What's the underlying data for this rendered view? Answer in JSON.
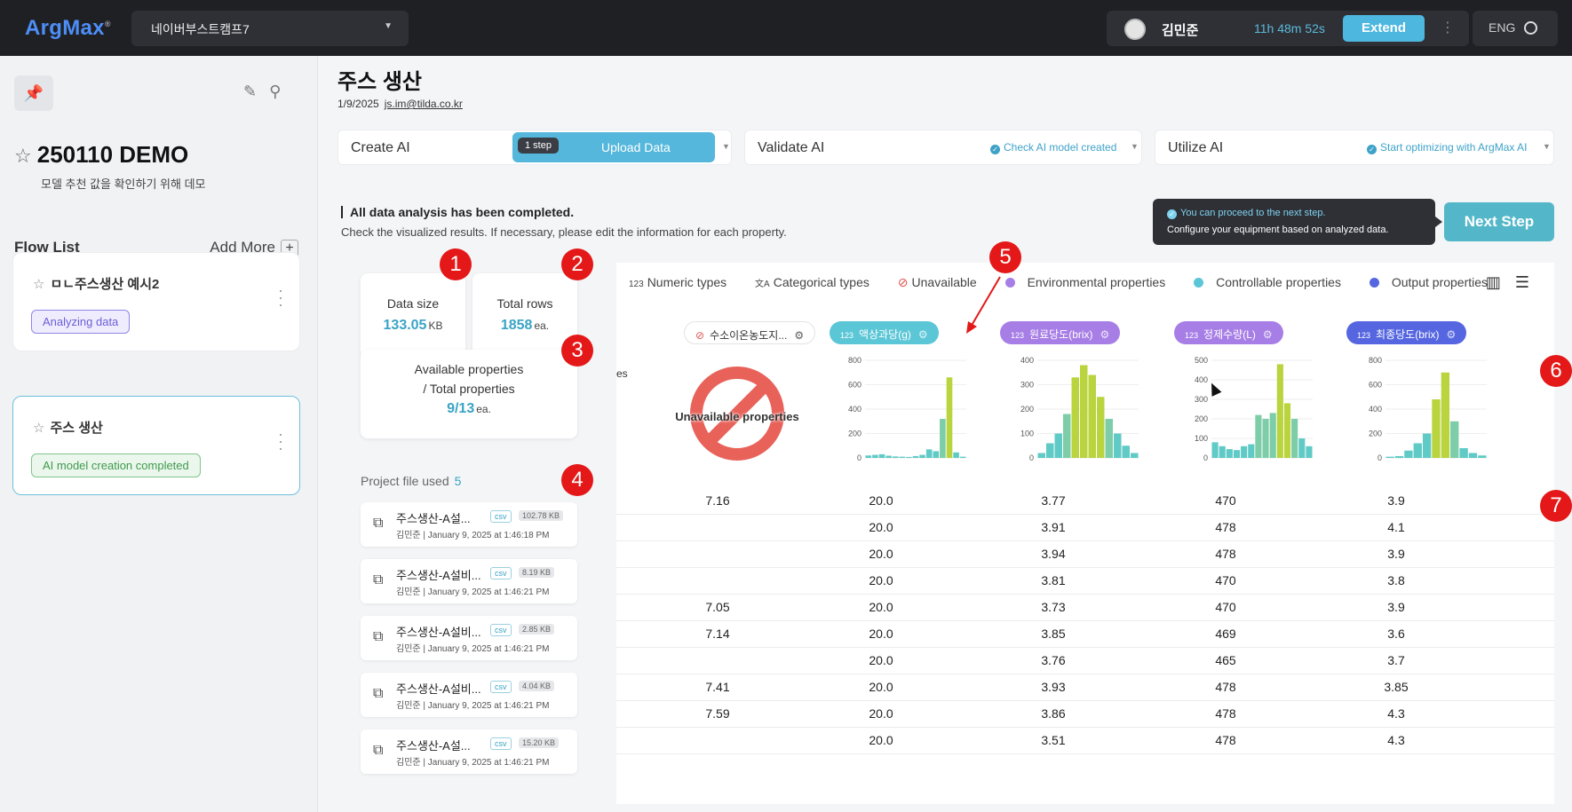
{
  "topbar": {
    "logo": "ArgMax",
    "logo_mark": "®",
    "workspace": "네이버부스트캠프7",
    "user": "김민준",
    "timer": "11h 48m 52s",
    "extend_label": "Extend",
    "language": "ENG"
  },
  "sidebar": {
    "project_title": "250110 DEMO",
    "project_desc": "모델 추천 값을 확인하기 위해 데모",
    "flow_list_label": "Flow List",
    "add_more_label": "Add More",
    "flows": [
      {
        "name": "ㅁㄴ주스생산 예시2",
        "status": "Analyzing data"
      },
      {
        "name": "주스 생산",
        "status": "AI model creation completed"
      }
    ]
  },
  "main": {
    "title": "주스 생산",
    "date": "1/9/2025",
    "email": "js.im@tilda.co.kr",
    "steps": {
      "create_label": "Create AI",
      "step_num": "1 step",
      "step_pill": "Upload Data",
      "validate_label": "Validate AI",
      "validate_status": "Check AI model created",
      "utilize_label": "Utilize AI",
      "utilize_status": "Start optimizing with ArgMax AI"
    },
    "analysis_title": "All data analysis has been completed.",
    "analysis_sub": "Check the visualized results. If necessary, please edit the information for each property.",
    "tooltip_title": "You can proceed to the next step.",
    "tooltip_body": "Configure your equipment based on analyzed data.",
    "next_step_label": "Next Step"
  },
  "stats": {
    "data_size_label": "Data size",
    "data_size_value": "133.05",
    "data_size_unit": "KB",
    "total_rows_label": "Total rows",
    "total_rows_value": "1858",
    "total_rows_unit": "ea.",
    "props_label_1": "Available properties",
    "props_label_2": "/ Total properties",
    "props_value": "9/13",
    "props_unit": "ea.",
    "project_file_label": "Project file used",
    "project_file_count": "5",
    "files": [
      {
        "name": "주스생산-A설...",
        "type": "csv",
        "size": "102.78 KB",
        "meta": "김민준 | January 9, 2025 at 1:46:18 PM"
      },
      {
        "name": "주스생산-A설비...",
        "type": "csv",
        "size": "8.19 KB",
        "meta": "김민준 | January 9, 2025 at 1:46:21 PM"
      },
      {
        "name": "주스생산-A설비...",
        "type": "csv",
        "size": "2.85 KB",
        "meta": "김민준 | January 9, 2025 at 1:46:21 PM"
      },
      {
        "name": "주스생산-A설비...",
        "type": "csv",
        "size": "4.04 KB",
        "meta": "김민준 | January 9, 2025 at 1:46:21 PM"
      },
      {
        "name": "주스생산-A설...",
        "type": "csv",
        "size": "15.20 KB",
        "meta": "김민준 | January 9, 2025 at 1:46:21 PM"
      }
    ]
  },
  "legend": {
    "numeric": "Numeric types",
    "categorical": "Categorical types",
    "unavailable": "Unavailable",
    "environmental": "Environmental properties",
    "controllable": "Controllable properties",
    "output": "Output properties",
    "numeric_prefix": "123",
    "categorical_prefix": "文A"
  },
  "columns": {
    "partial_label": "es",
    "unavailable_col": "수소이온농도지...",
    "unavailable_text": "Unavailable properties",
    "c1": "액상과당(g)",
    "c2": "원료당도(brix)",
    "c3": "정제수량(L)",
    "c4": "최종당도(brix)",
    "type_prefix": "123"
  },
  "charts": [
    {
      "ticks": [
        "800",
        "600",
        "400",
        "200",
        "0"
      ],
      "max": 800,
      "color_top": "#c9d83a",
      "bars": [
        20,
        25,
        30,
        18,
        12,
        10,
        8,
        15,
        25,
        70,
        55,
        320,
        660,
        45,
        10
      ]
    },
    {
      "ticks": [
        "400",
        "300",
        "200",
        "100",
        "0"
      ],
      "max": 400,
      "color_top": "#c9d83a",
      "bars": [
        20,
        60,
        100,
        180,
        330,
        380,
        340,
        250,
        160,
        100,
        50,
        20
      ]
    },
    {
      "ticks": [
        "500",
        "400",
        "300",
        "200",
        "100",
        "0"
      ],
      "max": 500,
      "color_top": "#c9d83a",
      "bars": [
        80,
        60,
        45,
        40,
        60,
        70,
        220,
        200,
        230,
        480,
        280,
        200,
        100,
        60
      ]
    },
    {
      "ticks": [
        "800",
        "600",
        "400",
        "200",
        "0"
      ],
      "max": 800,
      "color_top": "#c9d83a",
      "bars": [
        10,
        15,
        60,
        120,
        200,
        480,
        700,
        300,
        80,
        40,
        20
      ]
    }
  ],
  "table": {
    "rows": [
      [
        "7.16",
        "20.0",
        "3.77",
        "470",
        "3.9"
      ],
      [
        "",
        "20.0",
        "3.91",
        "478",
        "4.1"
      ],
      [
        "",
        "20.0",
        "3.94",
        "478",
        "3.9"
      ],
      [
        "",
        "20.0",
        "3.81",
        "470",
        "3.8"
      ],
      [
        "7.05",
        "20.0",
        "3.73",
        "470",
        "3.9"
      ],
      [
        "7.14",
        "20.0",
        "3.85",
        "469",
        "3.6"
      ],
      [
        "",
        "20.0",
        "3.76",
        "465",
        "3.7"
      ],
      [
        "7.41",
        "20.0",
        "3.93",
        "478",
        "3.85"
      ],
      [
        "7.59",
        "20.0",
        "3.86",
        "478",
        "4.3"
      ],
      [
        "",
        "20.0",
        "3.51",
        "478",
        "4.3"
      ]
    ]
  },
  "annotations": [
    "1",
    "2",
    "3",
    "4",
    "5",
    "6",
    "7"
  ],
  "colors": {
    "accent": "#54b7db",
    "controllable": "#5bc6d6",
    "environmental": "#a77ee6",
    "output": "#5566e0",
    "annotation": "#e41818"
  }
}
